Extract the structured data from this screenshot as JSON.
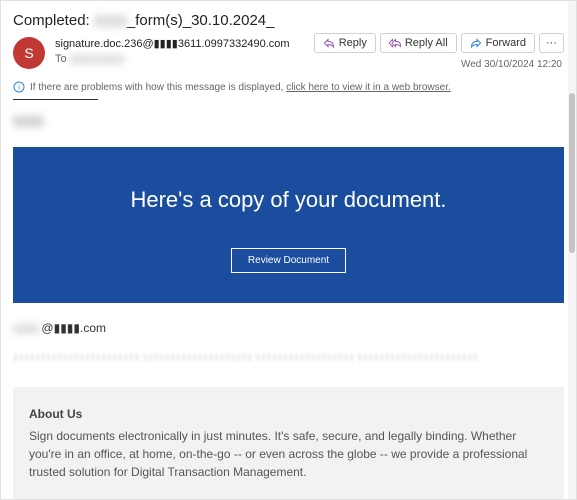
{
  "subject_prefix": "Completed: ",
  "subject_redacted": "_form(s)_30.10.2024_",
  "avatar_letter": "S",
  "sender_email": "signature.doc.236@▮▮▮▮3611.0997332490.com",
  "to_label": "To",
  "to_redacted": "▮▮▮▮▮▮▮▮▮",
  "actions": {
    "reply": "Reply",
    "reply_all": "Reply All",
    "forward": "Forward",
    "more": "···"
  },
  "timestamp": "Wed 30/10/2024 12:20",
  "info_bar": {
    "text": "If there are problems with how this message is displayed, ",
    "link": "click here to view it in a web browser.",
    "after": ""
  },
  "body": {
    "blur1": "▮▮▮▮",
    "blue_heading": "Here's a copy of your document.",
    "review_btn": "Review Document",
    "email_blur_left": "▮▮▮▮",
    "email_domain": "@▮▮▮▮.com",
    "faint": "▮▮▮▮▮▮▮▮▮▮▮▮▮▮▮▮▮▮▮▮▮▮▮\n▮▮▮▮▮▮▮▮▮▮▮▮▮▮▮▮▮▮▮▮\n▮▮▮▮▮▮▮▮▮▮▮▮▮▮▮▮▮▮\n▮▮▮▮▮▮▮▮▮▮▮▮▮▮▮▮▮▮▮▮▮▮"
  },
  "about": {
    "title": "About Us",
    "text": "Sign documents electronically in just minutes. It's safe, secure, and legally binding. Whether you're in an office, at home, on-the-go -- or even across the globe -- we provide a professional trusted solution for Digital Transaction Management."
  }
}
